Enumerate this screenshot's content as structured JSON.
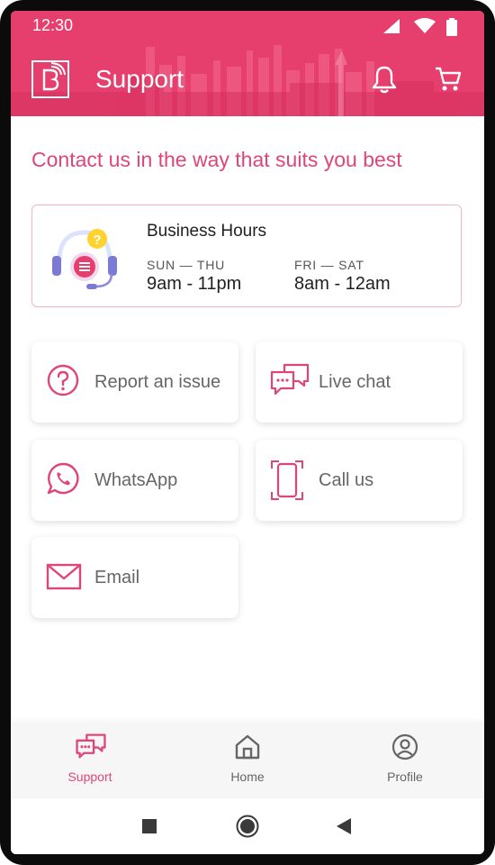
{
  "status_bar": {
    "time": "12:30"
  },
  "app_bar": {
    "title": "Support",
    "logo_icon": "brand-b-logo-icon",
    "actions": [
      "bell-icon",
      "cart-icon"
    ]
  },
  "headline": "Contact us in the way that suits you best",
  "business_hours": {
    "title": "Business Hours",
    "slots": [
      {
        "days": "SUN — THU",
        "hours": "9am - 11pm"
      },
      {
        "days": "FRI — SAT",
        "hours": "8am - 12am"
      }
    ]
  },
  "options": [
    {
      "label": "Report an issue",
      "icon": "question-circle-icon"
    },
    {
      "label": "Live chat",
      "icon": "chat-bubbles-icon"
    },
    {
      "label": "WhatsApp",
      "icon": "whatsapp-icon"
    },
    {
      "label": "Call us",
      "icon": "phone-icon"
    },
    {
      "label": "Email",
      "icon": "envelope-icon"
    }
  ],
  "bottom_nav": [
    {
      "label": "Support",
      "icon": "chat-bubbles-icon",
      "active": true
    },
    {
      "label": "Home",
      "icon": "home-icon",
      "active": false
    },
    {
      "label": "Profile",
      "icon": "user-circle-icon",
      "active": false
    }
  ],
  "colors": {
    "brand": "#e63e6d",
    "accent_text": "#e0457a",
    "card_border": "#f3b3c6",
    "muted_text": "#666666"
  }
}
